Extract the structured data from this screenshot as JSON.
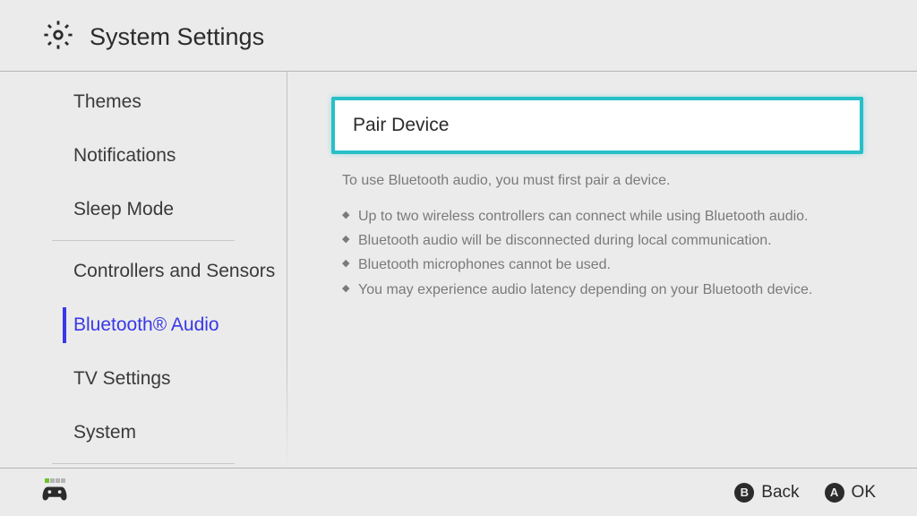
{
  "header": {
    "title": "System Settings"
  },
  "sidebar": {
    "items": [
      {
        "label": "Themes"
      },
      {
        "label": "Notifications"
      },
      {
        "label": "Sleep Mode"
      },
      {
        "label": "Controllers and Sensors"
      },
      {
        "label": "Bluetooth® Audio"
      },
      {
        "label": "TV Settings"
      },
      {
        "label": "System"
      }
    ],
    "activeIndex": 4
  },
  "main": {
    "pair_button_label": "Pair Device",
    "description": "To use Bluetooth audio, you must first pair a device.",
    "bullets": [
      "Up to two wireless controllers can connect while using Bluetooth audio.",
      "Bluetooth audio will be disconnected during local communication.",
      "Bluetooth microphones cannot be used.",
      "You may experience audio latency depending on your Bluetooth device."
    ]
  },
  "footer": {
    "back_label": "Back",
    "back_button": "B",
    "ok_label": "OK",
    "ok_button": "A"
  }
}
